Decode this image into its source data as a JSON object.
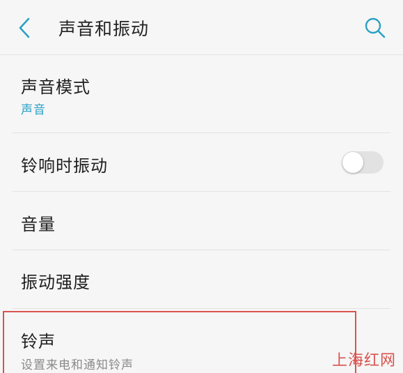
{
  "header": {
    "title": "声音和振动",
    "back_icon": "chevron-left-icon",
    "search_icon": "search-icon",
    "accent_color": "#2aa0c4"
  },
  "settings": {
    "sound_mode": {
      "label": "声音模式",
      "value": "声音"
    },
    "vibrate_on_ring": {
      "label": "铃响时振动",
      "enabled": false
    },
    "volume": {
      "label": "音量"
    },
    "vibration_intensity": {
      "label": "振动强度"
    },
    "ringtone": {
      "label": "铃声",
      "description": "设置来电和通知铃声"
    }
  },
  "annotation": {
    "highlight_color": "#d9534f"
  },
  "watermark": {
    "text": "上海红网"
  }
}
